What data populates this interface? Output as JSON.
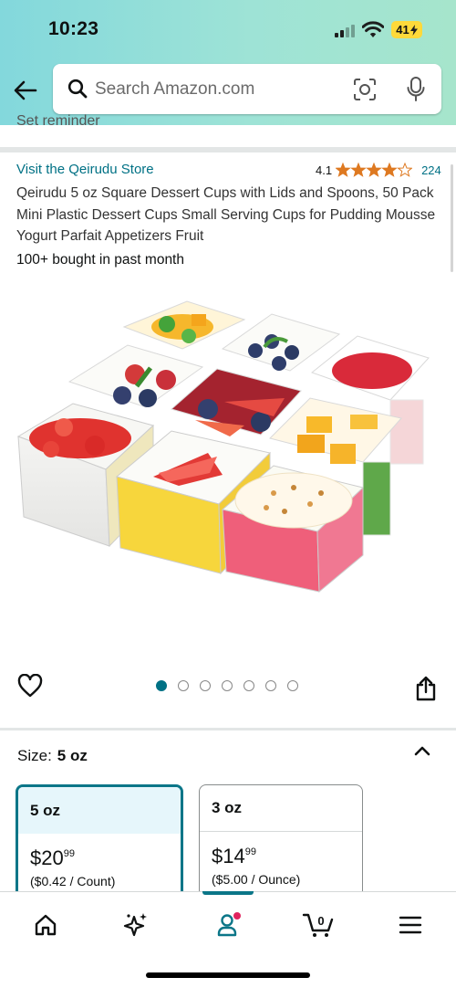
{
  "status_bar": {
    "time": "10:23",
    "battery": "41"
  },
  "search": {
    "placeholder": "Search Amazon.com"
  },
  "reminder_text": "Set reminder",
  "product": {
    "store_link": "Visit the Qeirudu Store",
    "rating": "4.1",
    "rating_value": 4.1,
    "rating_count": "224",
    "title": "Qeirudu 5 oz Square Dessert Cups with Lids and Spoons, 50 Pack Mini Plastic Dessert Cups Small Serving Cups for Pudding Mousse Yogurt Parfait Appetizers Fruit",
    "bought": "100+ bought in past month"
  },
  "gallery": {
    "image_count": 7,
    "active_index": 0
  },
  "size": {
    "label": "Size:",
    "selected": "5 oz",
    "options": [
      {
        "name": "5 oz",
        "price_whole": "$20",
        "price_cents": "99",
        "unit_price": "($0.42 / Count)"
      },
      {
        "name": "3 oz",
        "price_whole": "$14",
        "price_cents": "99",
        "unit_price": "($5.00 / Ounce)"
      }
    ]
  },
  "nav": {
    "items": [
      "home-icon",
      "sparkle-icon",
      "account-icon",
      "cart-icon",
      "menu-icon"
    ],
    "cart_count": "0",
    "accent_color": "#0b7688",
    "notification_color": "#e0245e"
  },
  "colors": {
    "link": "#007185",
    "star": "#de7921",
    "selected_border": "#0b7688",
    "header_gradient_start": "#83d8dc",
    "header_gradient_end": "#a6e5cc"
  }
}
